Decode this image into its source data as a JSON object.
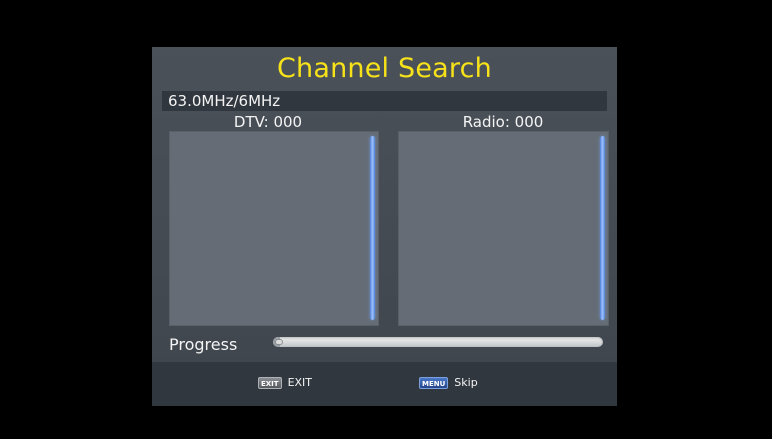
{
  "dialog": {
    "title": "Channel Search",
    "title_color": "#f7e21a",
    "frequency": "63.0MHz/6MHz"
  },
  "columns": {
    "dtv_label": "DTV: 000",
    "radio_label": "Radio: 000"
  },
  "progress": {
    "label": "Progress",
    "value_percent": 2
  },
  "footer": {
    "exit": {
      "key_label": "EXIT",
      "text": "EXIT",
      "icon": "exit-key-icon"
    },
    "skip": {
      "key_label": "MENU",
      "text": "Skip",
      "icon": "menu-key-icon"
    }
  }
}
